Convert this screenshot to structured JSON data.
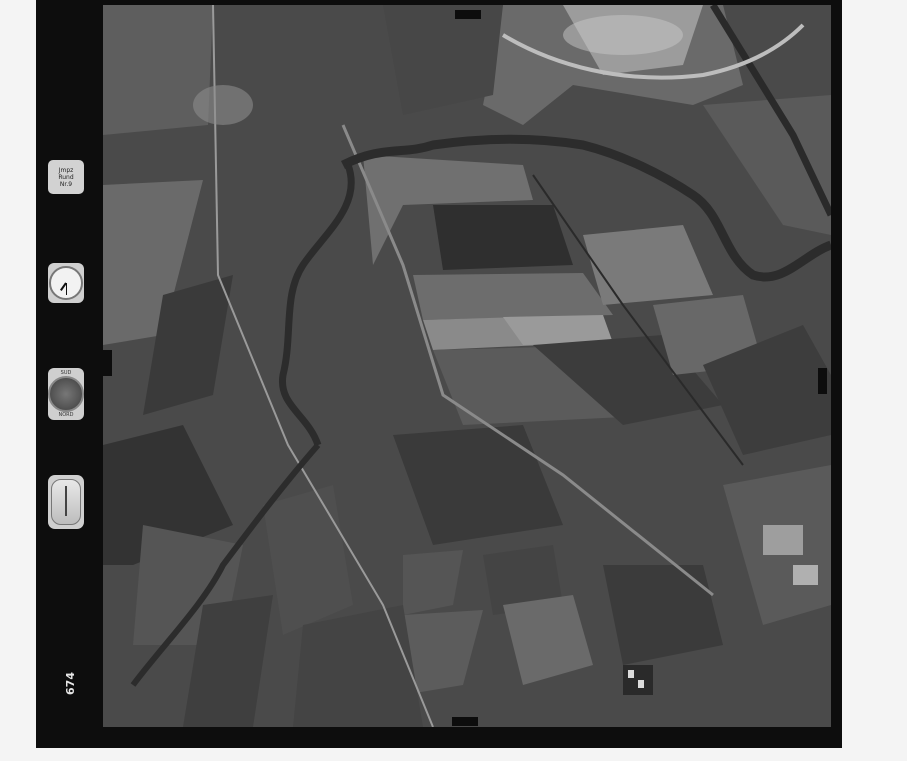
{
  "frame": {
    "number": "674"
  },
  "instruments": {
    "label_card_lines": [
      "Jmpz",
      "Rund",
      "Nr.9"
    ],
    "compass_label_top": "SUD",
    "compass_label_bottom": "NORD"
  },
  "colors": {
    "film_border": "#0d0d0d",
    "page_background": "#f4f4f4"
  }
}
